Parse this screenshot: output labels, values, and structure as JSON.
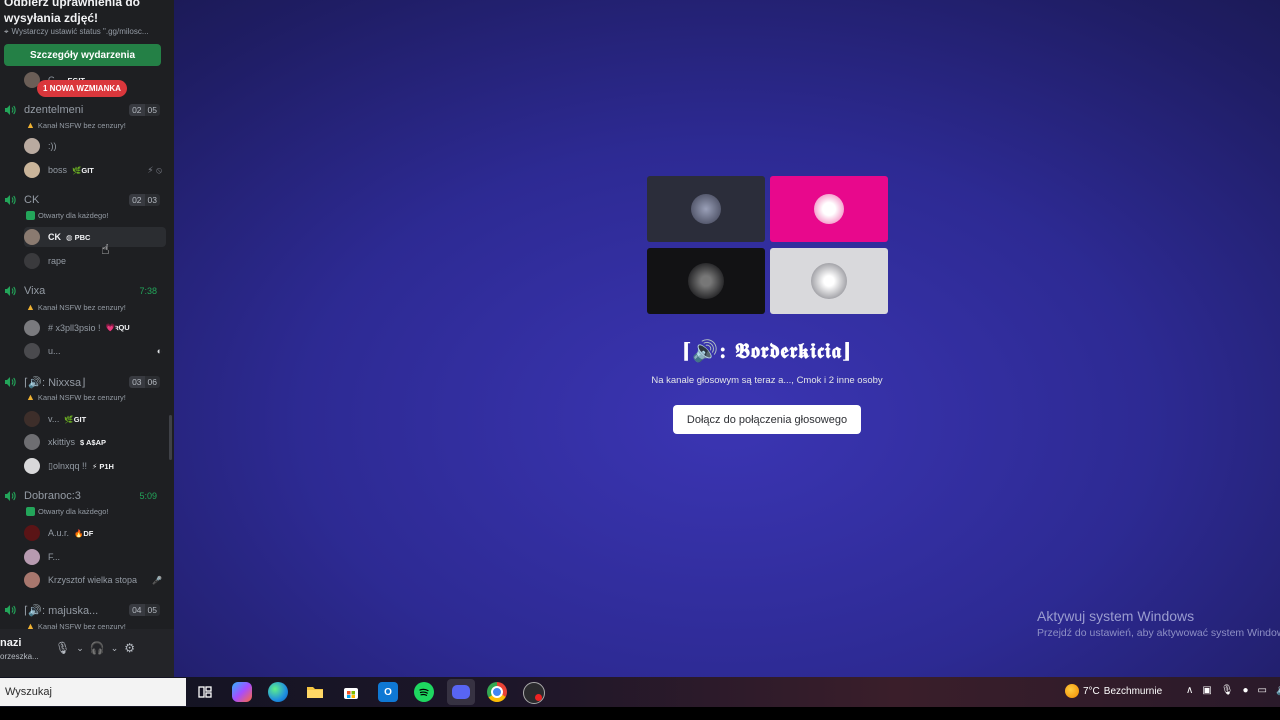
{
  "sidebar": {
    "event_title": "Odbierz uprawnienia do wysyłania zdjęć!",
    "event_status": "Wystarczy ustawić status \".gg/milosc...",
    "event_button": "Szczegóły wydarzenia",
    "mention_badge": "1 NOWA WZMIANKA",
    "top_member": {
      "name": "G...",
      "tag": "EGIT"
    },
    "channels": [
      {
        "name": "dzentelmeni",
        "counter": [
          "02",
          "05"
        ],
        "desc": "Kanał NSFW bez cenzury!",
        "desc_type": "nsfw",
        "members": [
          {
            "name": ":))",
            "tag": ""
          },
          {
            "name": "boss",
            "tag": "GIT",
            "tag_icon": "🌿",
            "right": "⚡ ⦸"
          }
        ]
      },
      {
        "name": "CK",
        "counter": [
          "02",
          "03"
        ],
        "desc": "Otwarty dla każdego!",
        "desc_type": "open",
        "members": [
          {
            "name": "CK",
            "tag": "PBC",
            "tag_icon": "◍"
          },
          {
            "name": "rape",
            "tag": ""
          }
        ]
      },
      {
        "name": "Vixa",
        "timer": "7:38",
        "desc": "Kanał NSFW bez cenzury!",
        "desc_type": "nsfw",
        "members": [
          {
            "name": "# x3pll3psio !",
            "tag": "ꝛQU",
            "tag_icon": "💗"
          },
          {
            "name": "u...",
            "tag": "",
            "right": "◐"
          }
        ]
      },
      {
        "name": "⌈🔊: Nixxsa⌋",
        "counter": [
          "03",
          "06"
        ],
        "desc": "Kanał NSFW bez cenzury!",
        "desc_type": "nsfw",
        "members": [
          {
            "name": "v...",
            "tag": "GIT",
            "tag_icon": "🌿"
          },
          {
            "name": "xkittiys",
            "tag": "A$AP",
            "tag_icon": "$"
          },
          {
            "name": "▯olnxqq !!",
            "tag": "P1H",
            "tag_icon": "⚡"
          }
        ]
      },
      {
        "name": "Dobranoc:3",
        "timer": "5:09",
        "desc": "Otwarty dla każdego!",
        "desc_type": "open",
        "members": [
          {
            "name": "A.u.r.",
            "tag": "DF",
            "tag_icon": "🔥"
          },
          {
            "name": "F...",
            "tag": ""
          },
          {
            "name": "Krzysztof wielka stopa",
            "tag": "",
            "right": "🎤"
          }
        ]
      },
      {
        "name": "⌈🔊: majuska...",
        "counter": [
          "04",
          "05"
        ],
        "desc": "Kanał NSFW bez cenzury!",
        "desc_type": "nsfw",
        "members": []
      }
    ],
    "user_panel": {
      "name": "nazi",
      "status": "orzeszka..."
    }
  },
  "main": {
    "title": "⌈🔊: 𝕭𝖔𝖗𝖉𝖊𝖗𝖐𝖎𝖈𝖎𝖆⌋",
    "subtitle": "Na kanale głosowym są teraz a..., Cmok i 2 inne osoby",
    "join_button": "Dołącz do połączenia głosowego",
    "tile_colors": [
      "#2b2d3a",
      "#e8088c",
      "#121214",
      "#d9d9dc"
    ],
    "watermark_title": "Aktywuj system Windows",
    "watermark_sub": "Przejdź do ustawień, aby aktywować system Windows."
  },
  "taskbar": {
    "search_placeholder": "Wyszukaj",
    "weather_temp": "7°C",
    "weather_desc": "Bezchmurnie",
    "apps": [
      "task-view",
      "copilot",
      "edge",
      "file-explorer",
      "store",
      "outlook",
      "spotify",
      "discord",
      "chrome",
      "obs"
    ]
  },
  "colors": {
    "accent_green": "#248046",
    "mention_red": "#da373c",
    "pink_tile": "#e8088c"
  }
}
